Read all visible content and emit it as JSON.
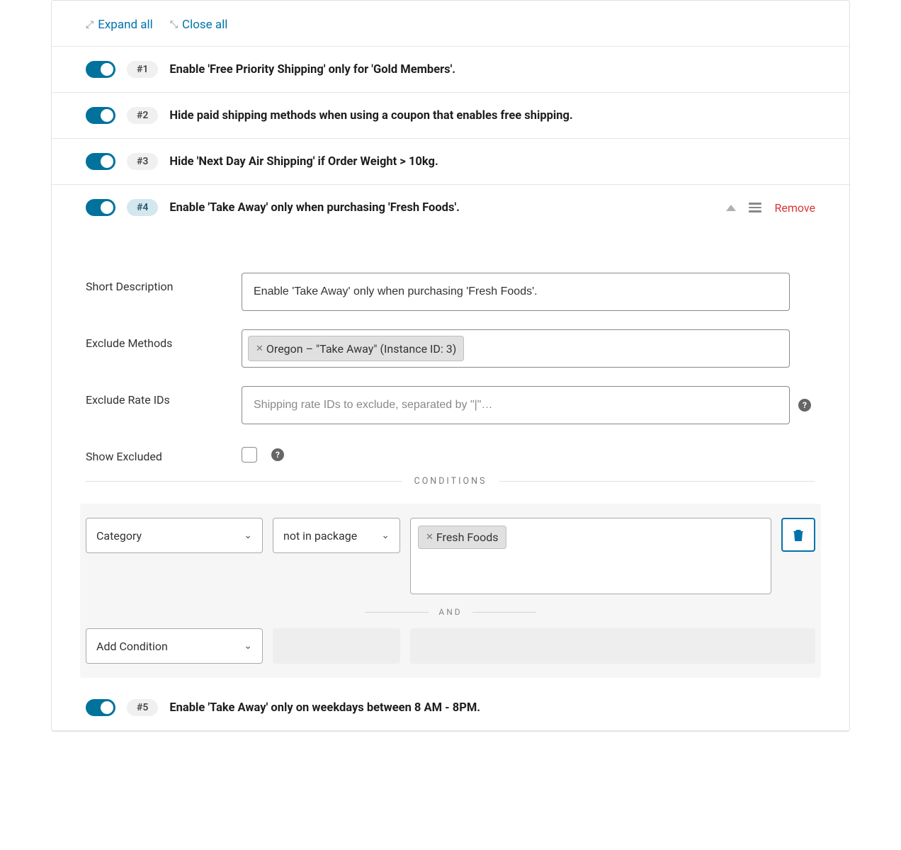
{
  "header": {
    "expand_all": "Expand all",
    "close_all": "Close all"
  },
  "rules": {
    "r1": {
      "badge": "#1",
      "title": "Enable 'Free Priority Shipping' only for 'Gold Members'."
    },
    "r2": {
      "badge": "#2",
      "title": "Hide paid shipping methods when using a coupon that enables free shipping."
    },
    "r3": {
      "badge": "#3",
      "title": "Hide 'Next Day Air Shipping' if Order Weight > 10kg."
    },
    "r4": {
      "badge": "#4",
      "title": "Enable 'Take Away' only when purchasing 'Fresh Foods'."
    },
    "r5": {
      "badge": "#5",
      "title": "Enable 'Take Away' only on weekdays between 8 AM - 8PM."
    }
  },
  "actions": {
    "remove": "Remove"
  },
  "form": {
    "short_description_label": "Short Description",
    "short_description_value": "Enable 'Take Away' only when purchasing 'Fresh Foods'.",
    "exclude_methods_label": "Exclude Methods",
    "exclude_methods_tag": "Oregon – \"Take Away\" (Instance ID: 3)",
    "exclude_rate_ids_label": "Exclude Rate IDs",
    "exclude_rate_ids_placeholder": "Shipping rate IDs to exclude, separated by \"|\"…",
    "show_excluded_label": "Show Excluded"
  },
  "conditions": {
    "heading": "CONDITIONS",
    "field_select": "Category",
    "operator_select": "not in package",
    "value_tag": "Fresh Foods",
    "and_label": "AND",
    "add_condition": "Add Condition"
  }
}
